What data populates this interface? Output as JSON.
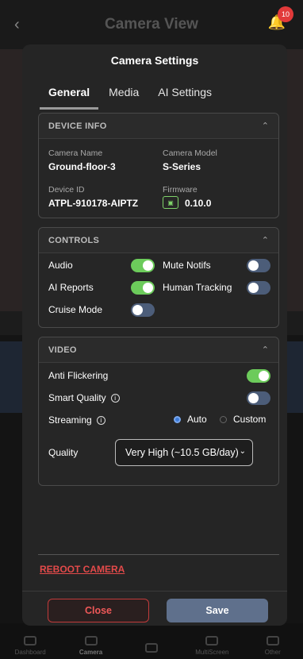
{
  "background": {
    "title": "Camera View",
    "notification_count": "10",
    "nav": [
      "Dashboard",
      "Camera",
      "",
      "MultiScreen",
      "Other"
    ]
  },
  "modal": {
    "title": "Camera Settings",
    "tabs": [
      {
        "label": "General",
        "active": true
      },
      {
        "label": "Media",
        "active": false
      },
      {
        "label": "AI Settings",
        "active": false
      }
    ],
    "device_info": {
      "heading": "DEVICE INFO",
      "camera_name_label": "Camera Name",
      "camera_name": "Ground-floor-3",
      "camera_model_label": "Camera Model",
      "camera_model": "S-Series",
      "device_id_label": "Device ID",
      "device_id": "ATPL-910178-AIPTZ",
      "firmware_label": "Firmware",
      "firmware": "0.10.0"
    },
    "controls": {
      "heading": "CONTROLS",
      "items": [
        {
          "label": "Audio",
          "on": true
        },
        {
          "label": "Mute Notifs",
          "on": false
        },
        {
          "label": "AI Reports",
          "on": true
        },
        {
          "label": "Human Tracking",
          "on": false
        },
        {
          "label": "Cruise Mode",
          "on": false
        }
      ]
    },
    "video": {
      "heading": "VIDEO",
      "anti_flickering_label": "Anti Flickering",
      "anti_flickering_on": true,
      "smart_quality_label": "Smart Quality",
      "smart_quality_on": false,
      "streaming_label": "Streaming",
      "streaming_options": [
        "Auto",
        "Custom"
      ],
      "streaming_selected": "Auto",
      "quality_label": "Quality",
      "quality_value": "Very High (~10.5 GB/day)"
    },
    "reboot_label": "REBOOT CAMERA",
    "close_label": "Close",
    "save_label": "Save"
  },
  "colors": {
    "toggle_on": "#6ccb5b",
    "toggle_off": "#4c5d79",
    "danger": "#e34a4a",
    "primary": "#5f708c",
    "radio_selected": "#3d7bd9"
  }
}
